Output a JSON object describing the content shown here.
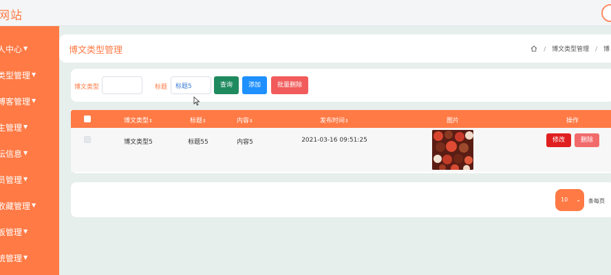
{
  "header": {
    "site_title": "网站"
  },
  "sidebar": {
    "items": [
      {
        "label": "人中心"
      },
      {
        "label": "类型管理"
      },
      {
        "label": "博客管理"
      },
      {
        "label": "主管理"
      },
      {
        "label": "坛信息"
      },
      {
        "label": "员管理"
      },
      {
        "label": "收藏管理"
      },
      {
        "label": "板管理"
      },
      {
        "label": "统管理"
      }
    ]
  },
  "page": {
    "title": "博文类型管理",
    "breadcrumb": [
      "博文类型管理",
      "博"
    ]
  },
  "search": {
    "type_label": "博文类型",
    "type_value": "",
    "title_label": "标题",
    "title_value": "标题5",
    "query_btn": "查询",
    "add_btn": "添加",
    "batch_delete_btn": "批量删除"
  },
  "table": {
    "columns": [
      "博文类型",
      "标题",
      "内容",
      "发布时间",
      "图片",
      "操作"
    ],
    "sort_glyph": "⇕",
    "rows": [
      {
        "type": "博文类型5",
        "title": "标题55",
        "content": "内容5",
        "time": "2021-03-16 09:51:25",
        "edit": "修改",
        "delete": "删除"
      }
    ]
  },
  "pagination": {
    "page_size": "10",
    "per_page_label": "条每页"
  },
  "colors": {
    "accent": "#ff7a45",
    "query": "#1f8a5e",
    "add": "#1e90ff",
    "danger": "#f15b5b",
    "edit": "#e02020"
  }
}
